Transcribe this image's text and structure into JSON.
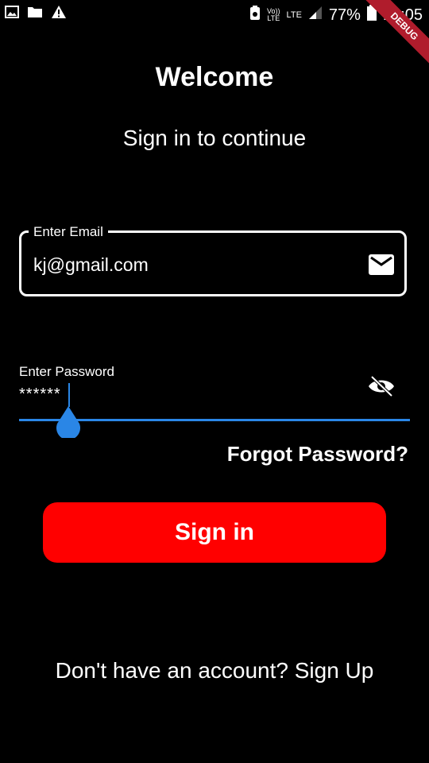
{
  "status_bar": {
    "volte_line1": "Vo))",
    "volte_line2": "LTE",
    "lte_label": "LTE",
    "battery_text": "77%",
    "time": "16:05",
    "icons": [
      "image-icon",
      "folder-icon",
      "warning-icon",
      "signal-icon",
      "battery-icon"
    ]
  },
  "debug_banner": "DEBUG",
  "header": {
    "title": "Welcome",
    "subtitle": "Sign in to continue"
  },
  "email": {
    "label": "Enter Email",
    "value": "kj@gmail.com",
    "icon": "mail-icon"
  },
  "password": {
    "label": "Enter Password",
    "value": "******",
    "icon": "eye-off-icon"
  },
  "forgot_label": "Forgot Password?",
  "signin_label": "Sign in",
  "signup_text": "Don't have an account? Sign Up",
  "colors": {
    "background": "#000000",
    "accent": "#2a86e6",
    "button": "#ff0000",
    "debug": "#b01c2c"
  }
}
